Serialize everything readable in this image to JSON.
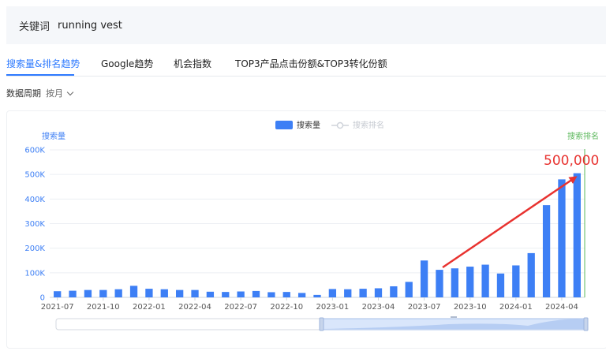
{
  "keyword": {
    "label": "关键词",
    "value": "running vest"
  },
  "tabs": [
    {
      "label": "搜索量&排名趋势",
      "active": true
    },
    {
      "label": "Google趋势",
      "active": false
    },
    {
      "label": "机会指数",
      "active": false
    },
    {
      "label": "TOP3产品点击份额&TOP3转化份额",
      "active": false
    }
  ],
  "period": {
    "label": "数据周期",
    "value": "按月"
  },
  "chart_data": {
    "type": "bar",
    "legend": {
      "placement": "top-center",
      "items": [
        {
          "name": "搜索量",
          "active": true
        },
        {
          "name": "搜索排名",
          "active": false
        }
      ]
    },
    "y_left_label": "搜索量",
    "y_right_label": "搜索排名",
    "ylim": [
      0,
      600000
    ],
    "y_ticks": [
      "0",
      "100K",
      "200K",
      "300K",
      "400K",
      "500K",
      "600K"
    ],
    "categories": [
      "2021-07",
      "2021-08",
      "2021-09",
      "2021-10",
      "2021-11",
      "2021-12",
      "2022-01",
      "2022-02",
      "2022-03",
      "2022-04",
      "2022-05",
      "2022-06",
      "2022-07",
      "2022-08",
      "2022-09",
      "2022-10",
      "2022-11",
      "2022-12",
      "2023-01",
      "2023-02",
      "2023-03",
      "2023-04",
      "2023-05",
      "2023-06",
      "2023-07",
      "2023-08",
      "2023-09",
      "2023-10",
      "2023-11",
      "2023-12",
      "2024-01",
      "2024-02",
      "2024-03",
      "2024-04",
      "2024-05"
    ],
    "x_tick_labels": [
      "2021-07",
      "2021-10",
      "2022-01",
      "2022-04",
      "2022-07",
      "2022-10",
      "2023-01",
      "2023-04",
      "2023-07",
      "2023-10",
      "2024-01",
      "2024-04"
    ],
    "series": [
      {
        "name": "搜索量",
        "color": "#3d7ff5",
        "values": [
          25000,
          27000,
          30000,
          30000,
          33000,
          47000,
          35000,
          33000,
          30000,
          30000,
          23000,
          22000,
          24000,
          26000,
          21000,
          22000,
          18000,
          10000,
          34000,
          33000,
          35000,
          37000,
          45000,
          63000,
          150000,
          112000,
          118000,
          125000,
          133000,
          97000,
          130000,
          180000,
          375000,
          480000,
          505000
        ]
      }
    ],
    "annotation": {
      "text": "500,000",
      "color": "#e8322f"
    },
    "right_axis_color": "#5cb85c"
  }
}
